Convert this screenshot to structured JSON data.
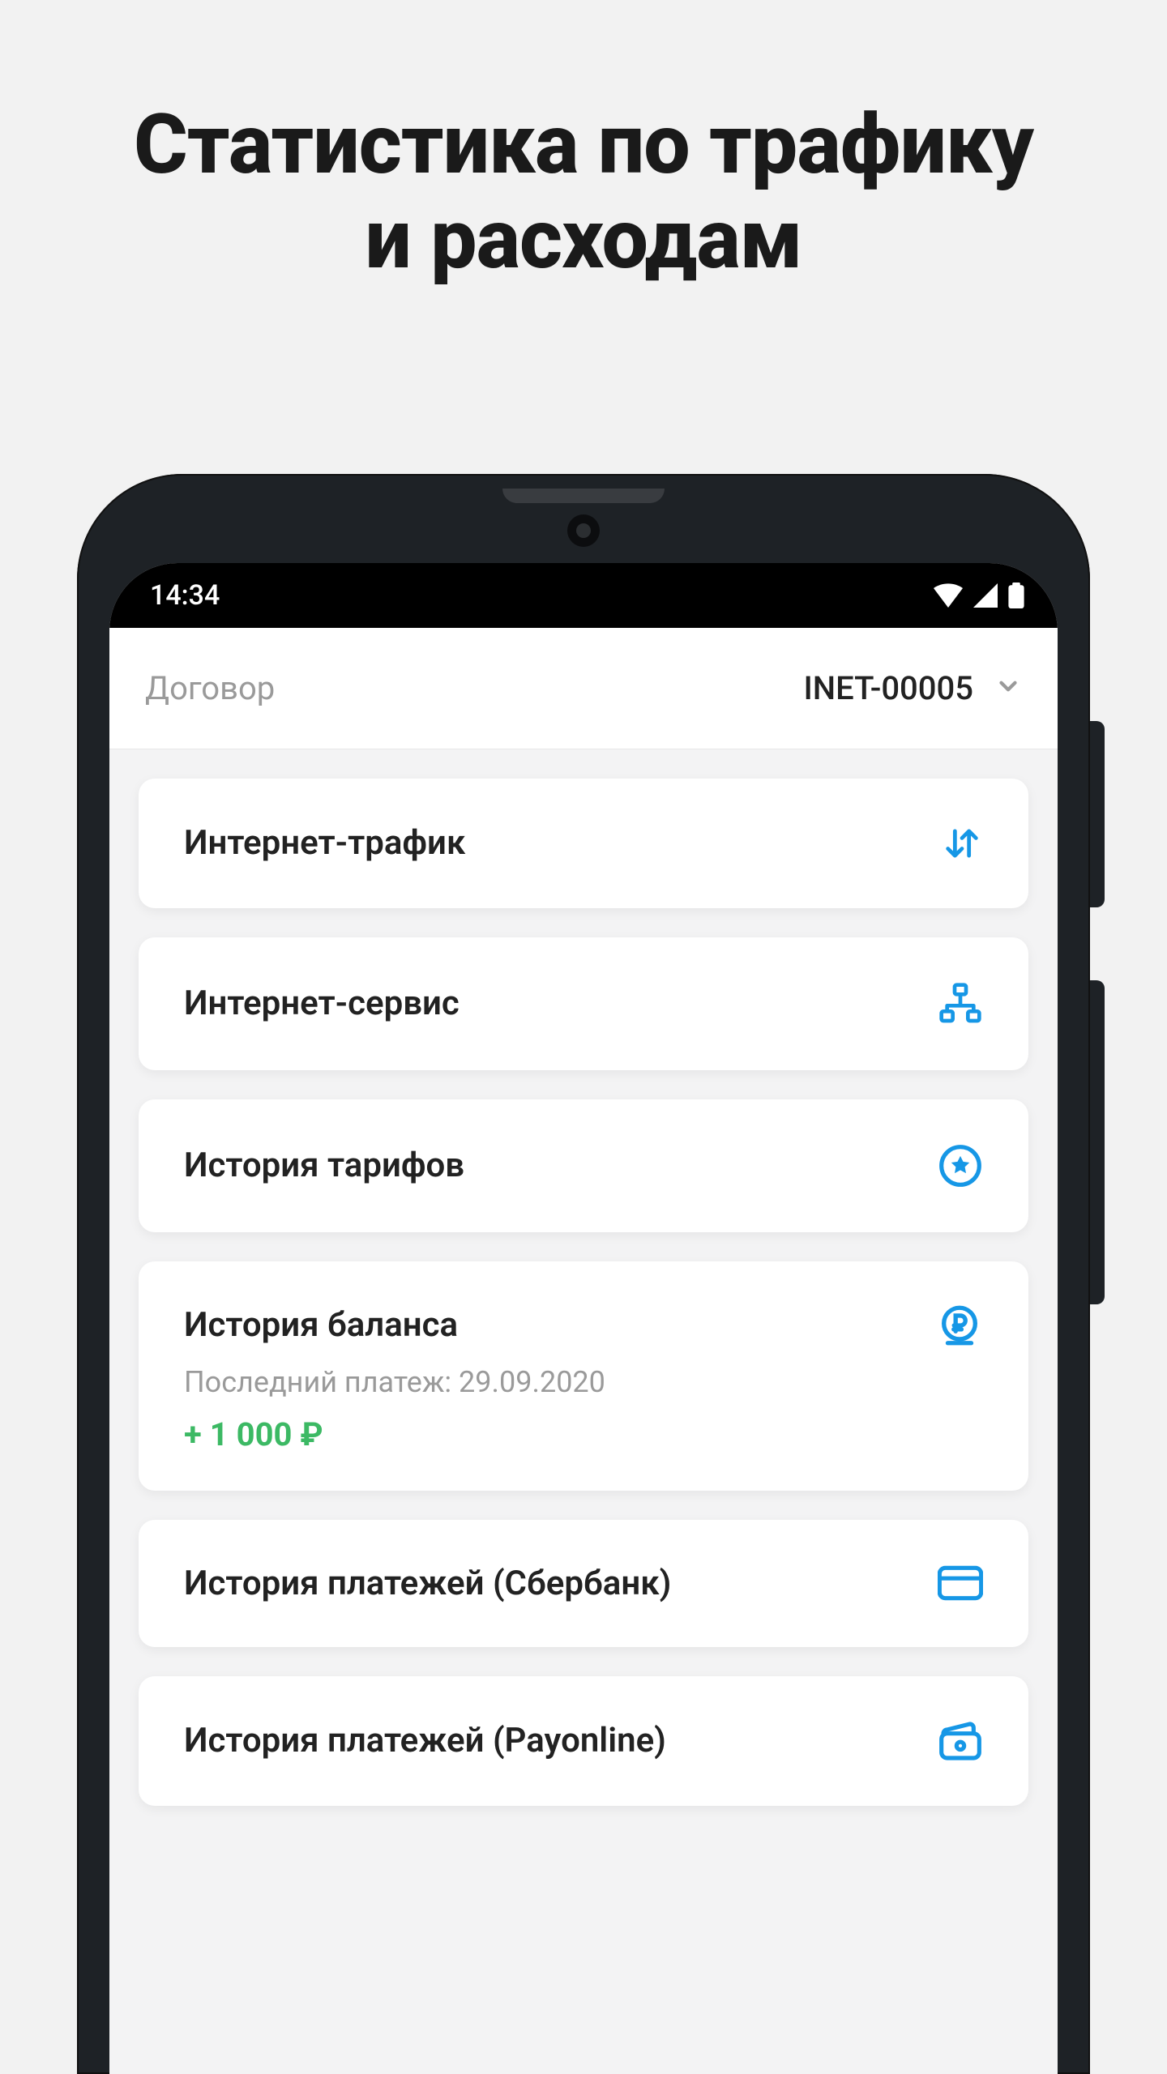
{
  "page": {
    "headline_l1": "Статистика по трафику",
    "headline_l2": "и расходам"
  },
  "status": {
    "time": "14:34"
  },
  "topbar": {
    "label": "Договор",
    "value": "INET-00005"
  },
  "cards": {
    "traffic": {
      "title": "Интернет-трафик"
    },
    "service": {
      "title": "Интернет-сервис"
    },
    "tariffs": {
      "title": "История тарифов"
    },
    "balance": {
      "title": "История баланса",
      "subtitle": "Последний платеж: 29.09.2020",
      "amount": "+ 1 000 ₽"
    },
    "sberbank": {
      "title": "История платежей (Сбербанк)"
    },
    "payonline": {
      "title": "История платежей (Payonline)"
    }
  },
  "colors": {
    "accent": "#1697e6",
    "positive": "#3cb964",
    "muted": "#9a9a9a"
  }
}
